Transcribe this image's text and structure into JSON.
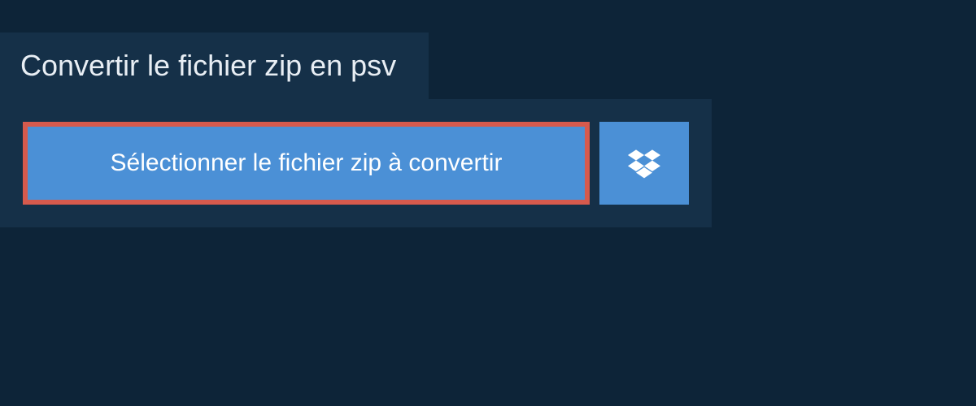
{
  "header": {
    "title": "Convertir le fichier zip en psv"
  },
  "upload": {
    "select_label": "Sélectionner le fichier zip à convertir"
  }
}
